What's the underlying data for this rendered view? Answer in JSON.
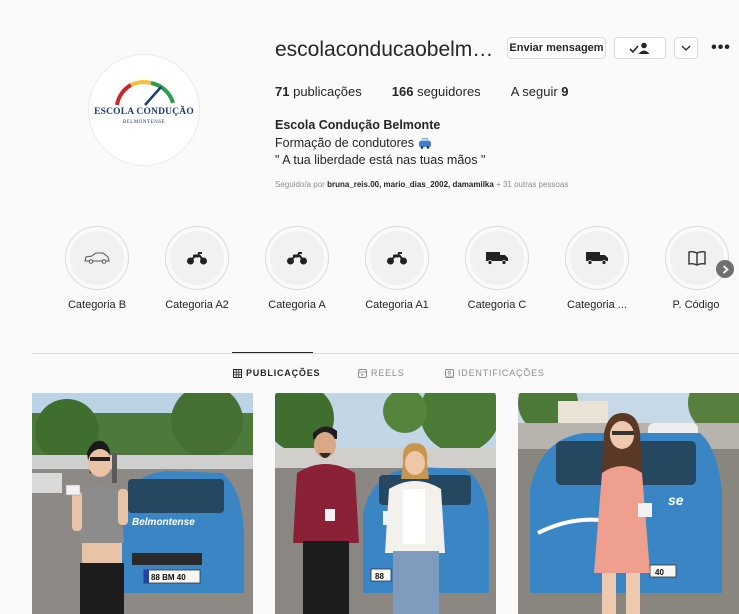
{
  "profile": {
    "username": "escolaconducaobelm…",
    "avatar_brand": "ESCOLA CONDUÇÃO",
    "avatar_brand_sub": "BELMONTENSE",
    "actions": {
      "message_label": "Enviar mensagem",
      "follow_icon": "user-check-icon",
      "dropdown_icon": "chevron-down-icon",
      "more_label": "•••"
    },
    "stats": {
      "posts_count": "71",
      "posts_label": "publicações",
      "followers_count": "166",
      "followers_label": "seguidores",
      "following_label": "A seguir",
      "following_count": "9"
    },
    "bio": {
      "name": "Escola Condução Belmonte",
      "line1": "Formação de condutores",
      "line1_icon": "car-icon",
      "line2": "\" A tua liberdade está nas tuas mãos \""
    },
    "followed_by": {
      "prefix": "Seguido/a por",
      "users": "bruna_reis.00, mario_dias_2002, damamilka",
      "suffix": "+ 31 outras pessoas"
    }
  },
  "highlights": [
    {
      "label": "Categoria B",
      "icon": "car-icon"
    },
    {
      "label": "Categoria A2",
      "icon": "motorcycle-icon"
    },
    {
      "label": "Categoria A",
      "icon": "motorcycle-icon"
    },
    {
      "label": "Categoria A1",
      "icon": "motorcycle-icon"
    },
    {
      "label": "Categoria C",
      "icon": "truck-icon"
    },
    {
      "label": "Categoria ...",
      "icon": "truck-icon"
    },
    {
      "label": "P. Código",
      "icon": "book-icon"
    }
  ],
  "tabs": [
    {
      "label": "PUBLICAÇÕES",
      "icon": "grid-icon",
      "active": true
    },
    {
      "label": "REELS",
      "icon": "reels-icon",
      "active": false
    },
    {
      "label": "IDENTIFICAÇÕES",
      "icon": "tag-icon",
      "active": false
    }
  ],
  "posts": [
    {
      "plate": "88 BM 40",
      "car_text": "Belmontense"
    },
    {
      "plate": "88",
      "car_text": ""
    },
    {
      "plate": "40",
      "car_text": "se"
    }
  ],
  "colors": {
    "accent": "#262626",
    "muted": "#8e8e8e",
    "border": "#dbdbdb",
    "brand_blue": "#1f3a78",
    "car_blue": "#3a86c4"
  }
}
